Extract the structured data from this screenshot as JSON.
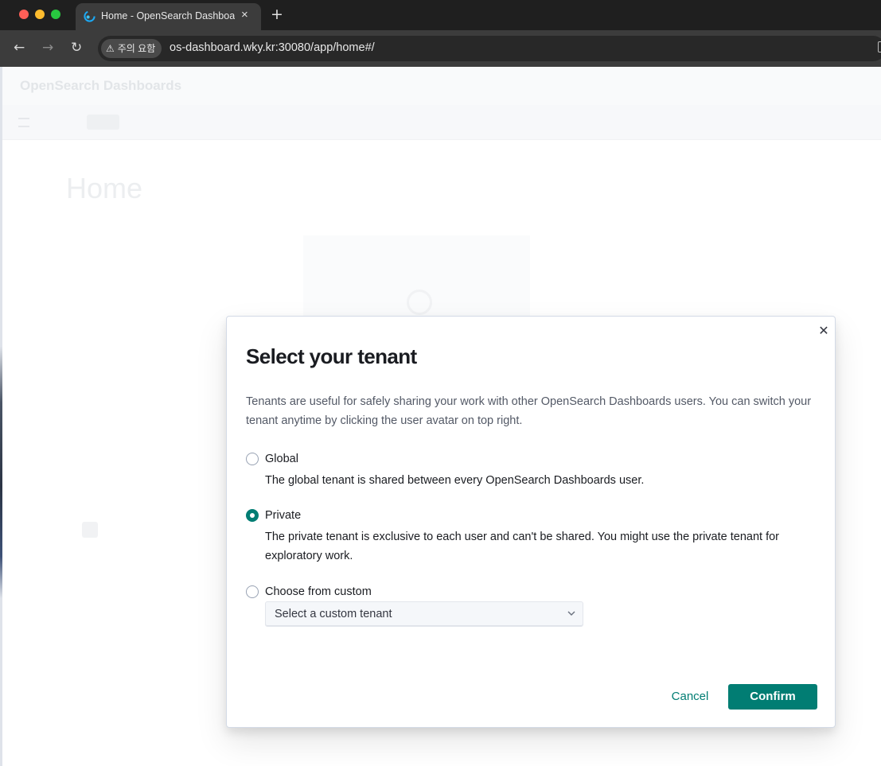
{
  "browser": {
    "tab_title": "Home - OpenSearch Dashboards",
    "tab_close_icon": "×",
    "new_tab_icon": "+",
    "security_chip": "주의 요함",
    "warning_icon": "⚠",
    "url": "os-dashboard.wky.kr:30080/app/home#/",
    "back_icon": "←",
    "forward_icon": "→",
    "reload_icon": "↻",
    "favicon_color": "#1ba9f5"
  },
  "background_page": {
    "page_title": "Home"
  },
  "modal": {
    "title": "Select your tenant",
    "description": "Tenants are useful for safely sharing your work with other OpenSearch Dashboards users. You can switch your tenant anytime by clicking the user avatar on top right.",
    "close_icon": "✕",
    "options": [
      {
        "label": "Global",
        "help": "The global tenant is shared between every OpenSearch Dashboards user.",
        "checked": false
      },
      {
        "label": "Private",
        "help": "The private tenant is exclusive to each user and can't be shared. You might use the private tenant for exploratory work.",
        "checked": true
      },
      {
        "label": "Choose from custom",
        "checked": false
      }
    ],
    "custom_select_placeholder": "Select a custom tenant",
    "cancel_label": "Cancel",
    "confirm_label": "Confirm",
    "accent_color": "#017d73"
  }
}
